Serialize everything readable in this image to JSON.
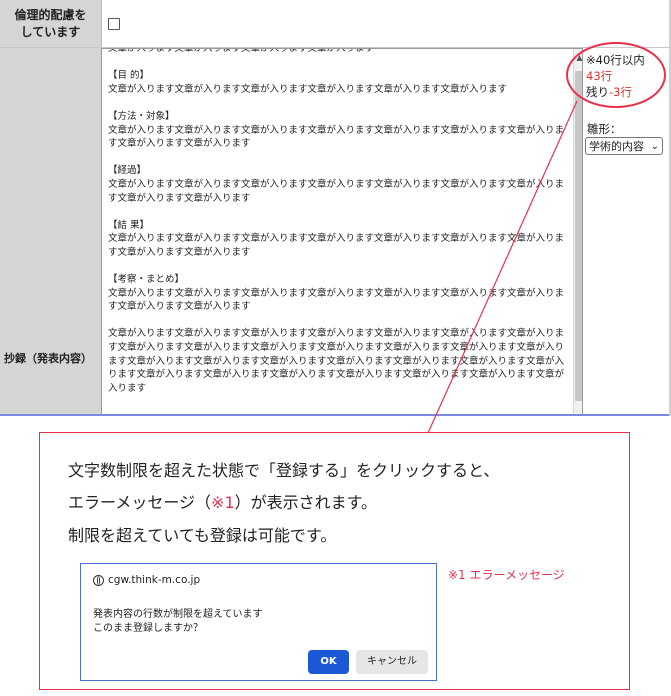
{
  "form": {
    "ethics_label": "倫理的配慮を\nしています",
    "abstract_label": "抄録（発表内容）",
    "abstract_text": "文章が入ります文章が入ります文章が入ります文章が入ります\n\n【目 的】\n文章が入ります文章が入ります文章が入ります文章が入ります文章が入ります文章が入ります\n\n【方法・対象】\n文章が入ります文章が入ります文章が入ります文章が入ります文章が入ります文章が入ります文章が入ります文章が入ります文章が入ります\n\n【経過】\n文章が入ります文章が入ります文章が入ります文章が入ります文章が入ります文章が入ります文章が入ります文章が入ります文章が入ります\n\n【結 果】\n文章が入ります文章が入ります文章が入ります文章が入ります文章が入ります文章が入ります文章が入ります文章が入ります文章が入ります\n\n【考察・まとめ】\n文章が入ります文章が入ります文章が入ります文章が入ります文章が入ります文章が入ります文章が入ります文章が入ります文章が入ります\n\n文章が入ります文章が入ります文章が入ります文章が入ります文章が入ります文章が入ります文章が入ります文章が入ります文章が入ります文章が入ります文章が入ります文章が入ります文章が入ります文章が入ります文章が入ります文章が入ります文章が入ります文章が入ります文章が入ります文章が入ります文章が入ります文章が入ります文章が入ります文章が入ります文章が入ります文章が入ります文章が入ります文章が入ります"
  },
  "counter": {
    "limit": "※40行以内",
    "current": "43行",
    "remaining_prefix": "残り",
    "remaining_value": "-3行"
  },
  "template": {
    "label": "雛形：",
    "selected": "学術的内容"
  },
  "callout": {
    "line1": "文字数制限を超えた状態で「登録する」をクリックすると、",
    "line2_a": "エラーメッセージ（",
    "line2_ref": "※1",
    "line2_b": "）が表示されます。",
    "line3": "制限を超えていても登録は可能です。",
    "error_tag": "※1 エラーメッセージ"
  },
  "dialog": {
    "host": "cgw.think-m.co.jp",
    "message": "発表内容の行数が制限を超えています\nこのまま登録しますか？",
    "ok_label": "OK",
    "cancel_label": "キャンセル"
  },
  "colors": {
    "accent_red": "#e8324d",
    "ok_blue": "#1a58d6",
    "dialog_border": "#4a74c9"
  }
}
